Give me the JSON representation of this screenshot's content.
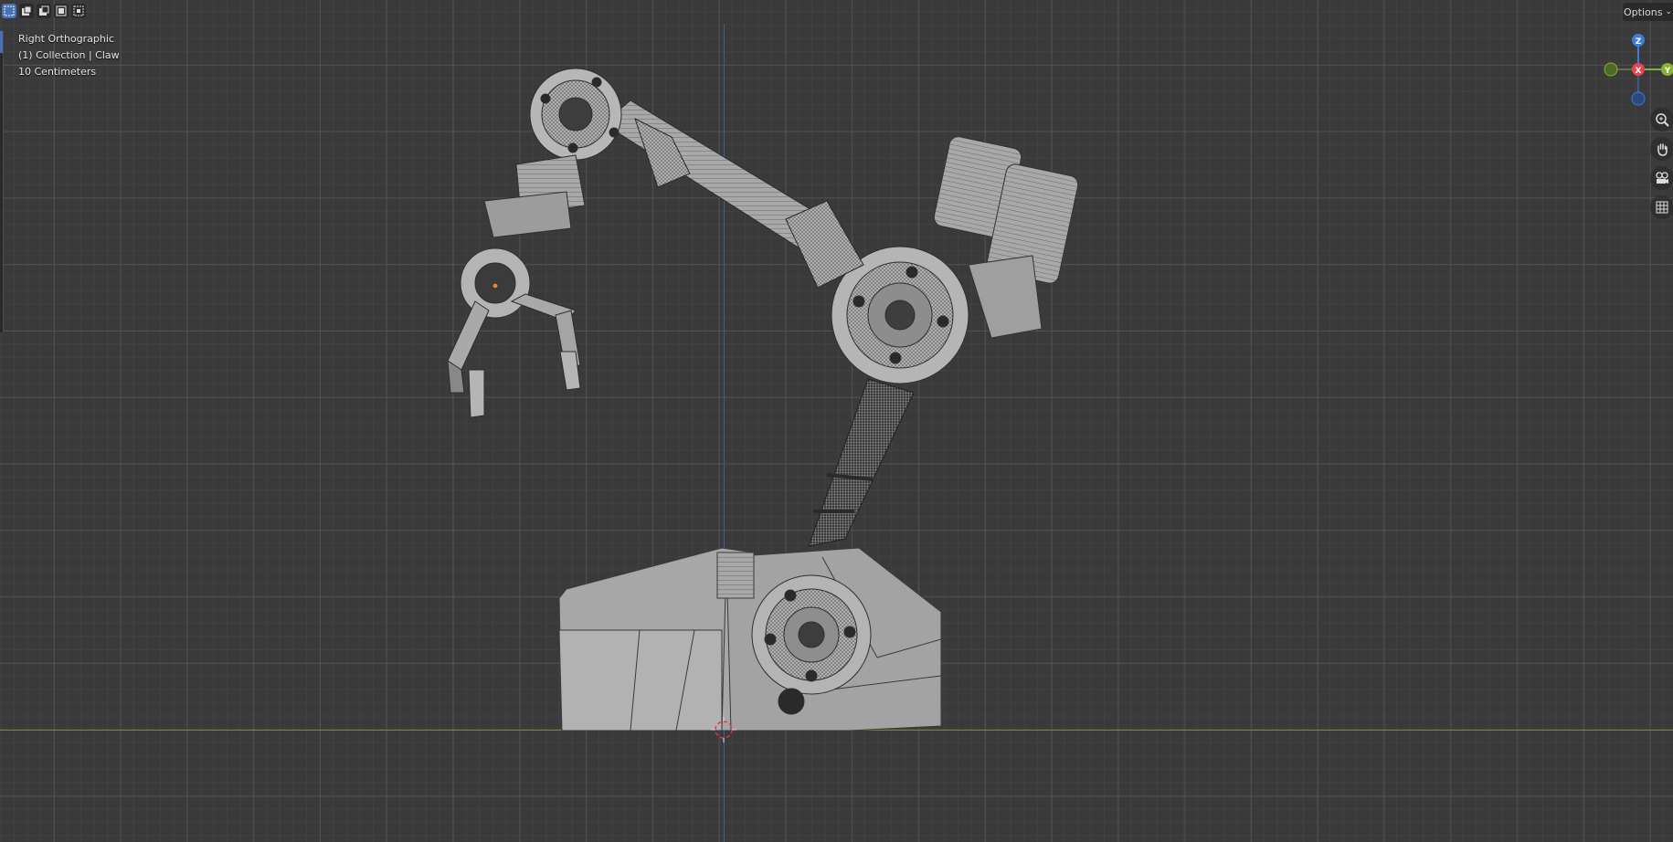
{
  "viewport": {
    "view_name": "Right Orthographic",
    "collection_info": "(1) Collection | Claw",
    "scale_info": "10 Centimeters"
  },
  "header": {
    "options_label": "Options",
    "options_chevron_icon": "chevron-down-icon"
  },
  "toolbar": {
    "tools": [
      "select-box-new-icon",
      "select-box-extend-icon",
      "select-box-subtract-icon",
      "select-box-invert-icon",
      "select-box-intersect-icon"
    ]
  },
  "gizmo": {
    "z_label": "Z",
    "x_label": "X",
    "y_label": "Y",
    "colors": {
      "x": "#e8434f",
      "y": "#86b131",
      "z": "#3d7bd9"
    }
  },
  "navigation": {
    "buttons": [
      "zoom-icon",
      "pan-hand-icon",
      "camera-icon",
      "grid-perspective-icon"
    ]
  },
  "colors": {
    "background": "#3a3a3a",
    "x_axis": "#6e8a3c",
    "z_axis": "#3d5f96",
    "mesh": "#a9a9a9",
    "wire": "#2b2b2b"
  }
}
